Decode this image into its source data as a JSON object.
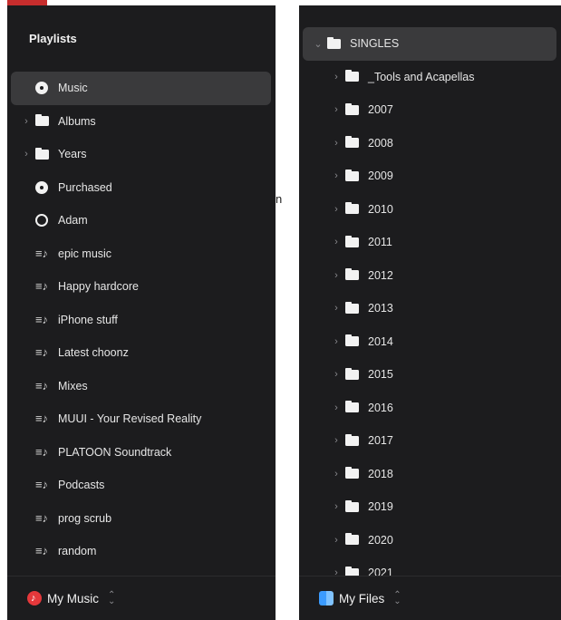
{
  "stray_text": "n",
  "left": {
    "title": "Playlists",
    "items": [
      {
        "label": "Music",
        "icon": "music-note-icon",
        "chevron": false,
        "selected": true
      },
      {
        "label": "Albums",
        "icon": "folder-icon",
        "chevron": true,
        "selected": false
      },
      {
        "label": "Years",
        "icon": "folder-icon",
        "chevron": true,
        "selected": false
      },
      {
        "label": "Purchased",
        "icon": "purchased-icon",
        "chevron": false,
        "selected": false
      },
      {
        "label": "Adam",
        "icon": "gear-icon",
        "chevron": false,
        "selected": false
      },
      {
        "label": "epic music",
        "icon": "playlist-icon",
        "chevron": false,
        "selected": false
      },
      {
        "label": "Happy hardcore",
        "icon": "playlist-icon",
        "chevron": false,
        "selected": false
      },
      {
        "label": "iPhone stuff",
        "icon": "playlist-icon",
        "chevron": false,
        "selected": false
      },
      {
        "label": "Latest choonz",
        "icon": "playlist-icon",
        "chevron": false,
        "selected": false
      },
      {
        "label": "Mixes",
        "icon": "playlist-icon",
        "chevron": false,
        "selected": false
      },
      {
        "label": "MUUI - Your Revised Reality",
        "icon": "playlist-icon",
        "chevron": false,
        "selected": false
      },
      {
        "label": "PLATOON Soundtrack",
        "icon": "playlist-icon",
        "chevron": false,
        "selected": false
      },
      {
        "label": "Podcasts",
        "icon": "playlist-icon",
        "chevron": false,
        "selected": false
      },
      {
        "label": "prog scrub",
        "icon": "playlist-icon",
        "chevron": false,
        "selected": false
      },
      {
        "label": "random",
        "icon": "playlist-icon",
        "chevron": false,
        "selected": false
      }
    ],
    "footer": {
      "label": "My Music",
      "icon": "music-app-icon"
    }
  },
  "right": {
    "root": {
      "label": "SINGLES",
      "icon": "folder-icon",
      "expanded": true,
      "selected": true
    },
    "children": [
      "_Tools and Acapellas",
      "2007",
      "2008",
      "2009",
      "2010",
      "2011",
      "2012",
      "2013",
      "2014",
      "2015",
      "2016",
      "2017",
      "2018",
      "2019",
      "2020",
      "2021"
    ],
    "footer": {
      "label": "My Files",
      "icon": "finder-icon"
    }
  },
  "colors": {
    "panel_bg": "#1c1c1e",
    "selection": "#3a3a3c",
    "text": "#e6e6e6",
    "accent_red": "#e5383b",
    "accent_blue": "#3b9bff"
  }
}
